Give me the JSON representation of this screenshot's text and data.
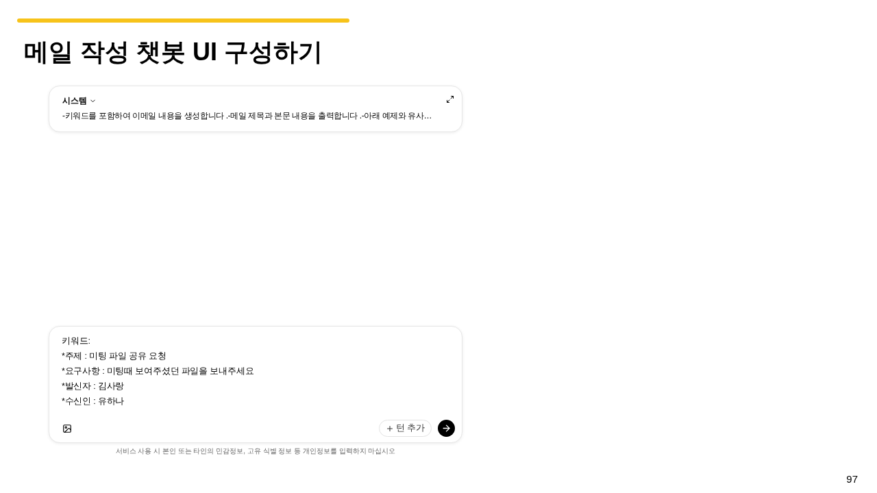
{
  "header": {
    "title": "메일 작성 챗봇 UI 구성하기"
  },
  "system_panel": {
    "label": "시스템",
    "content": "-키워드를 포함하여 이메일 내용을 생성합니다 .-메일 제목과 본문 내용을 출력합니다 .-아래 예제와 유사…"
  },
  "input_panel": {
    "value_lines": [
      "키워드:",
      "*주제 : 미팅 파일 공유 요청",
      "*요구사항 : 미팅때 보여주셨던 파일을 보내주세요",
      "*발신자 : 김사랑",
      "*수신인 : 유하나"
    ],
    "add_turn_button": "턴 추가"
  },
  "disclaimer": "서비스 사용 시 본인 또는 타인의 민감정보, 고유 식별 정보 등 개인정보를 입력하지 마십시오",
  "page_number": "97"
}
